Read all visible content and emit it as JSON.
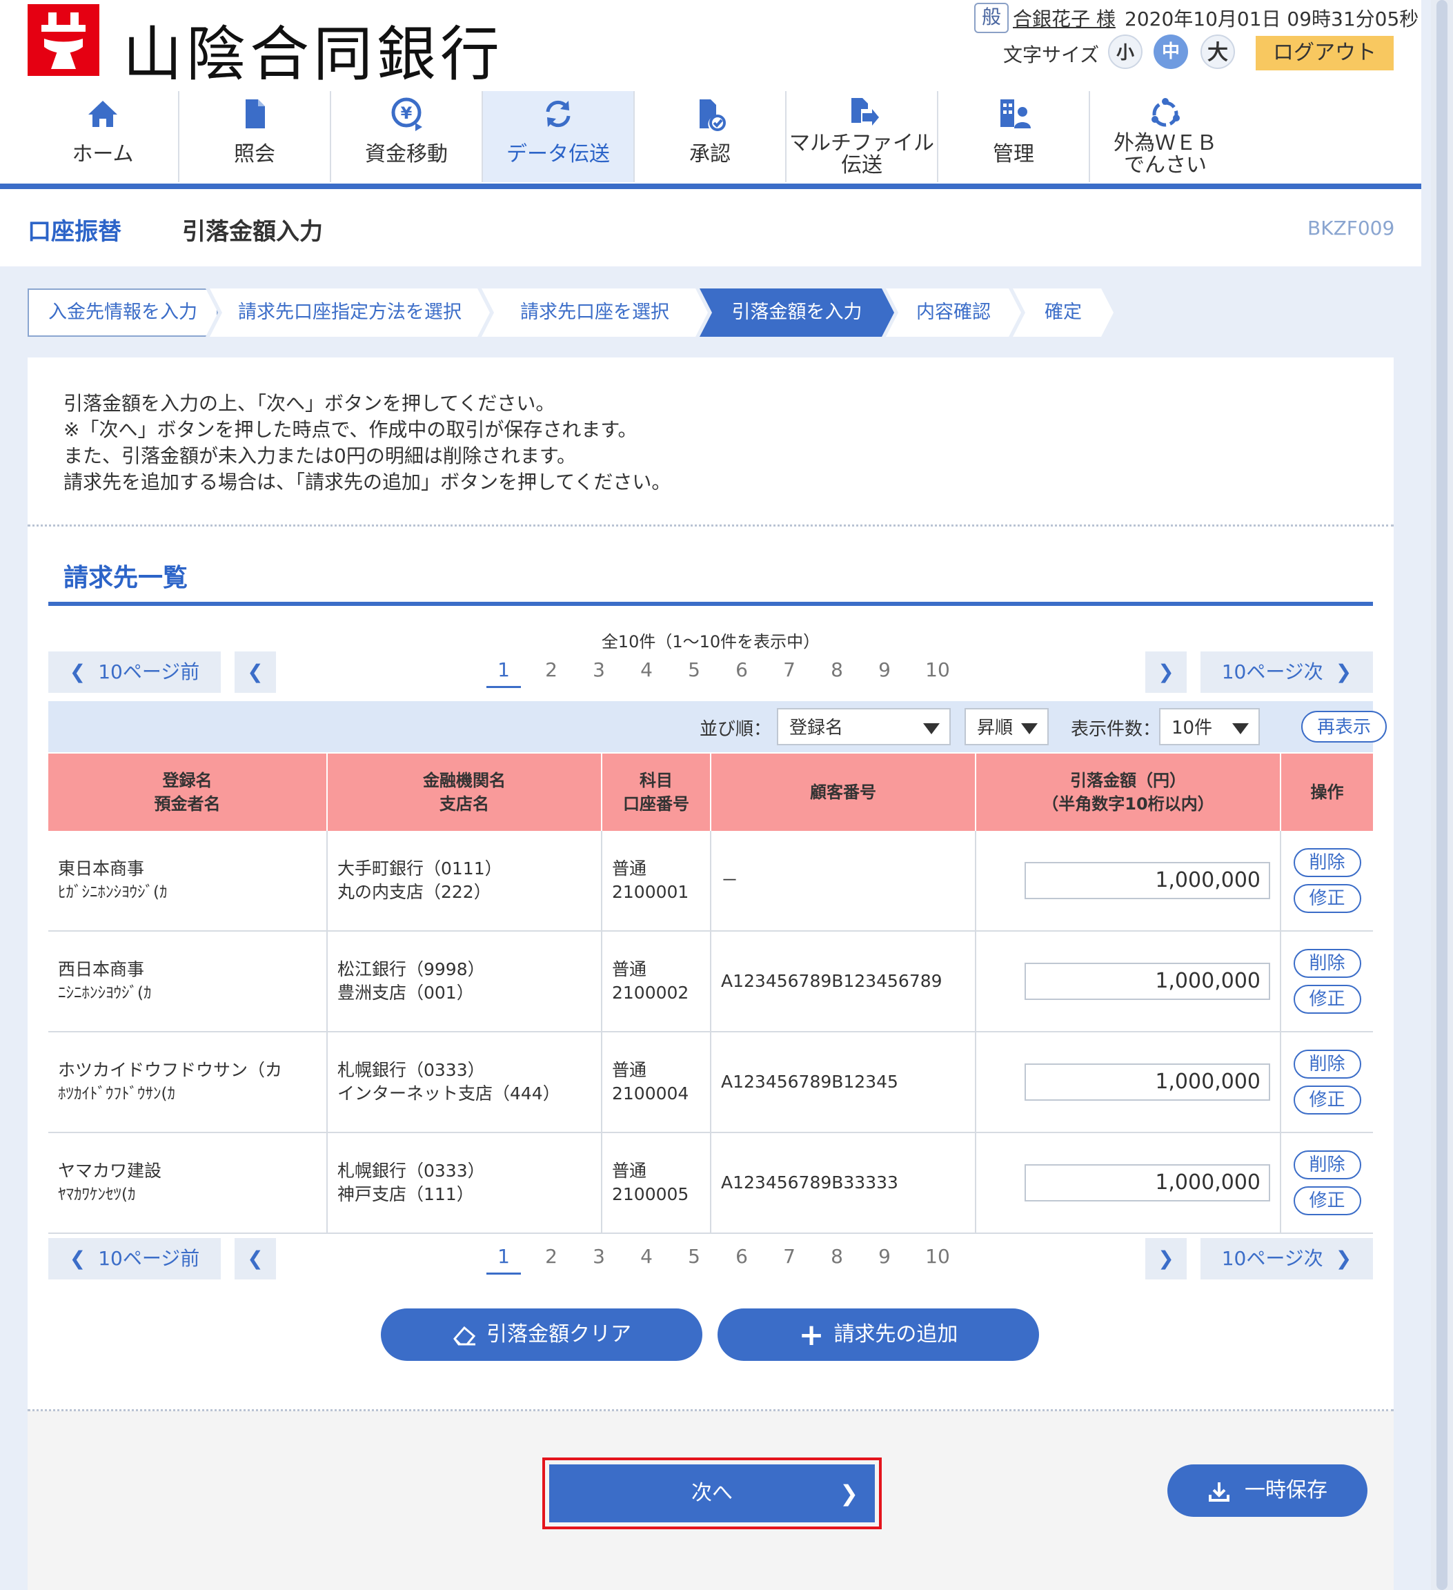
{
  "header": {
    "bank_name": "山陰合同銀行",
    "user_badge": "般",
    "user_name": "合銀花子 様",
    "datetime": "2020年10月01日 09時31分05秒",
    "font_size_label": "文字サイズ",
    "font_sizes": [
      "小",
      "中",
      "大"
    ],
    "logout_label": "ログアウト",
    "accent_color": "#3b6dc8"
  },
  "nav": {
    "items": [
      {
        "label": "ホーム",
        "icon": "home-icon"
      },
      {
        "label": "照会",
        "icon": "document-icon"
      },
      {
        "label": "資金移動",
        "icon": "yen-transfer-icon"
      },
      {
        "label": "データ伝送",
        "icon": "refresh-icon",
        "active": true
      },
      {
        "label": "承認",
        "icon": "approve-document-icon"
      },
      {
        "label": "マルチファイル",
        "label2": "伝送",
        "icon": "file-transfer-icon"
      },
      {
        "label": "管理",
        "icon": "admin-building-icon"
      },
      {
        "label": "外為ＷＥＢ",
        "label2": "でんさい",
        "icon": "forex-cycle-icon"
      }
    ]
  },
  "title": {
    "category": "口座振替",
    "page": "引落金額入力",
    "screen_id": "BKZF009"
  },
  "steps": [
    "入金先情報を入力",
    "請求先口座指定方法を選択",
    "請求先口座を選択",
    "引落金額を入力",
    "内容確認",
    "確定"
  ],
  "description": [
    "引落金額を入力の上、「次へ」ボタンを押してください。",
    "※「次へ」ボタンを押した時点で、作成中の取引が保存されます。",
    "また、引落金額が未入力または0円の明細は削除されます。",
    "請求先を追加する場合は、「請求先の追加」ボタンを押してください。"
  ],
  "section_title": "請求先一覧",
  "pagination": {
    "count_text": "全10件（1〜10件を表示中）",
    "prev10": "10ページ前",
    "next10": "10ページ次",
    "pages": [
      "1",
      "2",
      "3",
      "4",
      "5",
      "6",
      "7",
      "8",
      "9",
      "10"
    ],
    "current": "1"
  },
  "sort": {
    "order_label": "並び順：",
    "order_value": "登録名",
    "direction_value": "昇順",
    "per_page_label": "表示件数：",
    "per_page_value": "10件",
    "refresh_label": "再表示"
  },
  "table": {
    "headers": [
      {
        "l1": "登録名",
        "l2": "預金者名"
      },
      {
        "l1": "金融機関名",
        "l2": "支店名"
      },
      {
        "l1": "科目",
        "l2": "口座番号"
      },
      {
        "l1": "顧客番号",
        "l2": ""
      },
      {
        "l1": "引落金額（円）",
        "l2": "（半角数字10桁以内）"
      },
      {
        "l1": "操作",
        "l2": ""
      }
    ],
    "rows": [
      {
        "name": "東日本商事",
        "kana": "ﾋｶﾞｼﾆﾎﾝｼﾖｳｼﾞ(ｶ",
        "bank": "大手町銀行（0111）",
        "branch": "丸の内支店（222）",
        "type": "普通",
        "account": "2100001",
        "customer": "－",
        "amount": "1,000,000"
      },
      {
        "name": "西日本商事",
        "kana": "ﾆｼﾆﾎﾝｼﾖｳｼﾞ(ｶ",
        "bank": "松江銀行（9998）",
        "branch": "豊洲支店（001）",
        "type": "普通",
        "account": "2100002",
        "customer": "A123456789B123456789",
        "amount": "1,000,000"
      },
      {
        "name": "ホツカイドウフドウサン（カ",
        "kana": "ﾎﾂｶｲﾄﾞｳﾌﾄﾞｳｻﾝ(ｶ",
        "bank": "札幌銀行（0333）",
        "branch": "インターネット支店（444）",
        "type": "普通",
        "account": "2100004",
        "customer": "A123456789B12345",
        "amount": "1,000,000"
      },
      {
        "name": "ヤマカワ建設",
        "kana": "ﾔﾏｶﾜｹﾝｾﾂ(ｶ",
        "bank": "札幌銀行（0333）",
        "branch": "神戸支店（111）",
        "type": "普通",
        "account": "2100005",
        "customer": "A123456789B33333",
        "amount": "1,000,000"
      }
    ],
    "delete_label": "削除",
    "edit_label": "修正"
  },
  "actions": {
    "clear_label": "引落金額クリア",
    "add_label": "請求先の追加",
    "next_label": "次へ",
    "save_label": "一時保存"
  }
}
